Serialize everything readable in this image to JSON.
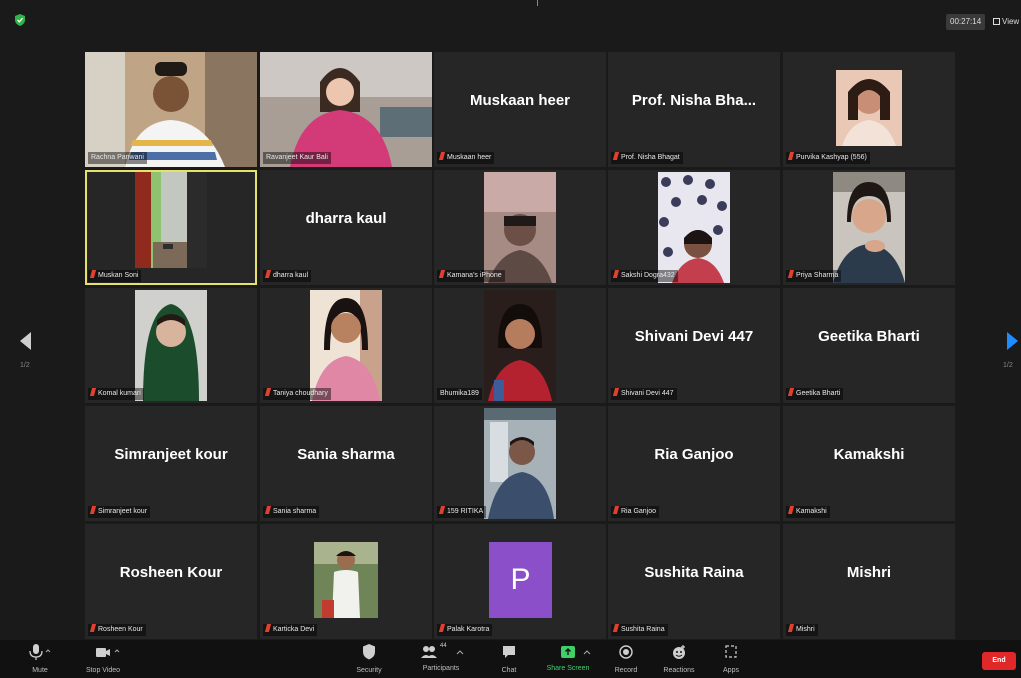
{
  "top": {
    "timer": "00:27:14",
    "view_label": "View"
  },
  "nav": {
    "page_left": "1/2",
    "page_right": "1/2"
  },
  "tiles": [
    {
      "label": "Rachna Panwani",
      "muted": false
    },
    {
      "label": "Ravanjeet Kaur Bali",
      "muted": false
    },
    {
      "label": "Muskaan heer",
      "name": "Muskaan heer",
      "muted": true
    },
    {
      "label": "Prof. Nisha Bhagat",
      "name": "Prof. Nisha Bha...",
      "muted": true
    },
    {
      "label": "Purvika Kashyap (556)",
      "muted": true
    },
    {
      "label": "Muskan Soni",
      "muted": true
    },
    {
      "label": "dharra kaul",
      "name": "dharra kaul",
      "muted": true
    },
    {
      "label": "Kamana's iPhone",
      "muted": true
    },
    {
      "label": "Sakshi Dogra432",
      "muted": true
    },
    {
      "label": "Priya Sharma",
      "muted": true
    },
    {
      "label": "Komal kumari",
      "muted": true
    },
    {
      "label": "Taniya choudhary",
      "muted": true
    },
    {
      "label": "Bhumika189",
      "muted": false
    },
    {
      "label": "Shivani Devi 447",
      "name": "Shivani Devi 447",
      "muted": true
    },
    {
      "label": "Geetika Bharti",
      "name": "Geetika Bharti",
      "muted": true
    },
    {
      "label": "Simranjeet kour",
      "name": "Simranjeet kour",
      "muted": true
    },
    {
      "label": "Sania sharma",
      "name": "Sania sharma",
      "muted": true
    },
    {
      "label": "159 RITIKA",
      "muted": true
    },
    {
      "label": "Ria Ganjoo",
      "name": "Ria Ganjoo",
      "muted": true
    },
    {
      "label": "Kamakshi",
      "name": "Kamakshi",
      "muted": true
    },
    {
      "label": "Rosheen Kour",
      "name": "Rosheen Kour",
      "muted": true
    },
    {
      "label": "Karticka Devi",
      "muted": true
    },
    {
      "label": "Palak Karotra",
      "avatar_letter": "P",
      "muted": true
    },
    {
      "label": "Sushita Raina",
      "name": "Sushita Raina",
      "muted": true
    },
    {
      "label": "Mishri",
      "name": "Mishri",
      "muted": true
    }
  ],
  "toolbar": {
    "mute": "Mute",
    "stop_video": "Stop Video",
    "security": "Security",
    "participants": "Participants",
    "participants_count": "44",
    "chat": "Chat",
    "share_screen": "Share Screen",
    "record": "Record",
    "reactions": "Reactions",
    "apps": "Apps",
    "end": "End"
  },
  "colors": {
    "mute_red": "#e0412f",
    "active_border": "#e4e26a",
    "share_green": "#3ed16a",
    "end_red": "#e02828",
    "avatar_purple": "#8b4fc9",
    "nav_blue": "#1e8cff"
  }
}
